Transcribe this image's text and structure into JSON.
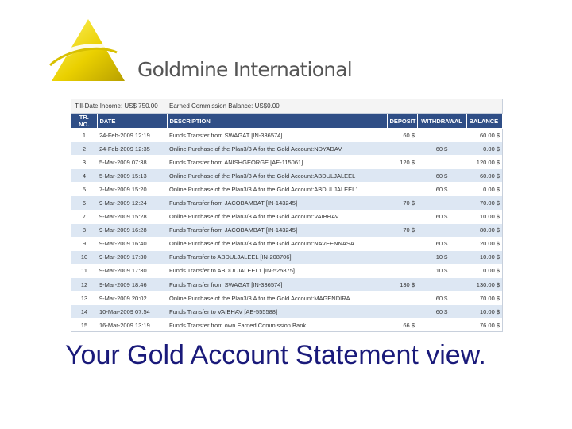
{
  "brand": {
    "name": "Goldmine International"
  },
  "statement": {
    "summary": {
      "till_date_income": "Till-Date Income: US$ 750.00",
      "earned_commission": "Earned Commission Balance: US$0.00"
    },
    "columns": [
      "TR. NO.",
      "DATE",
      "DESCRIPTION",
      "DEPOSIT",
      "WITHDRAWAL",
      "BALANCE"
    ],
    "rows": [
      [
        "1",
        "24-Feb-2009 12:19",
        "Funds Transfer from SWAGAT [IN-336574]",
        "60 $",
        "",
        "60.00 $"
      ],
      [
        "2",
        "24-Feb-2009 12:35",
        "Online Purchase of the Plan3/3 A for the Gold Account:NDYADAV",
        "",
        "60 $",
        "0.00 $"
      ],
      [
        "3",
        "5-Mar-2009 07:38",
        "Funds Transfer from ANISHGEORGE [AE-115061]",
        "120 $",
        "",
        "120.00 $"
      ],
      [
        "4",
        "5-Mar-2009 15:13",
        "Online Purchase of the Plan3/3 A for the Gold Account:ABDULJALEEL",
        "",
        "60 $",
        "60.00 $"
      ],
      [
        "5",
        "7-Mar-2009 15:20",
        "Online Purchase of the Plan3/3 A for the Gold Account:ABDULJALEEL1",
        "",
        "60 $",
        "0.00 $"
      ],
      [
        "6",
        "9-Mar-2009 12:24",
        "Funds Transfer from JACOBAMBAT [IN-143245]",
        "70 $",
        "",
        "70.00 $"
      ],
      [
        "7",
        "9-Mar-2009 15:28",
        "Online Purchase of the Plan3/3 A for the Gold Account:VAIBHAV",
        "",
        "60 $",
        "10.00 $"
      ],
      [
        "8",
        "9-Mar-2009 16:28",
        "Funds Transfer from JACOBAMBAT [IN-143245]",
        "70 $",
        "",
        "80.00 $"
      ],
      [
        "9",
        "9-Mar-2009 16:40",
        "Online Purchase of the Plan3/3 A for the Gold Account:NAVEENNASA",
        "",
        "60 $",
        "20.00 $"
      ],
      [
        "10",
        "9-Mar-2009 17:30",
        "Funds Transfer to ABDULJALEEL [IN-208706]",
        "",
        "10 $",
        "10.00 $"
      ],
      [
        "11",
        "9-Mar-2009 17:30",
        "Funds Transfer to ABDULJALEEL1 [IN-525875]",
        "",
        "10 $",
        "0.00 $"
      ],
      [
        "12",
        "9-Mar-2009 18:46",
        "Funds Transfer from SWAGAT [IN-336574]",
        "130 $",
        "",
        "130.00 $"
      ],
      [
        "13",
        "9-Mar-2009 20:02",
        "Online Purchase of the Plan3/3 A for the Gold Account:MAGENDIRA",
        "",
        "60 $",
        "70.00 $"
      ],
      [
        "14",
        "10-Mar-2009 07:54",
        "Funds Transfer to VAIBHAV [AE-555588]",
        "",
        "60 $",
        "10.00 $"
      ],
      [
        "15",
        "16-Mar-2009 13:19",
        "Funds Transfer from own Earned Commission Bank",
        "66 $",
        "",
        "76.00 $"
      ]
    ]
  },
  "caption": "Your Gold Account Statement view.",
  "colors": {
    "header_bg": "#2f4e86",
    "alt_row": "#dde7f3",
    "caption": "#1a1a7a",
    "gold": "#e8c800"
  }
}
